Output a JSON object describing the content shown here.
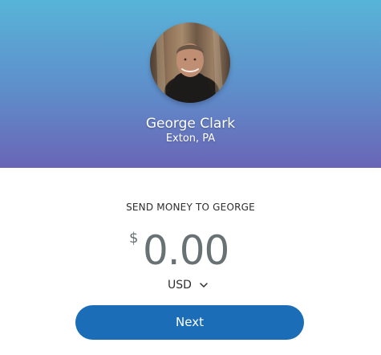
{
  "recipient": {
    "name": "George Clark",
    "location": "Exton, PA"
  },
  "send": {
    "label": "SEND MONEY TO GEORGE",
    "currency_symbol": "$",
    "amount": "0.00",
    "currency_code": "USD"
  },
  "actions": {
    "next_label": "Next"
  },
  "colors": {
    "header_gradient_top": "#58b4d8",
    "header_gradient_bottom": "#6a65b6",
    "primary_button": "#1b6db7",
    "amount_text": "#687173",
    "body_text": "#2c2e2f"
  },
  "icons": {
    "currency_dropdown": "chevron-down-icon"
  }
}
